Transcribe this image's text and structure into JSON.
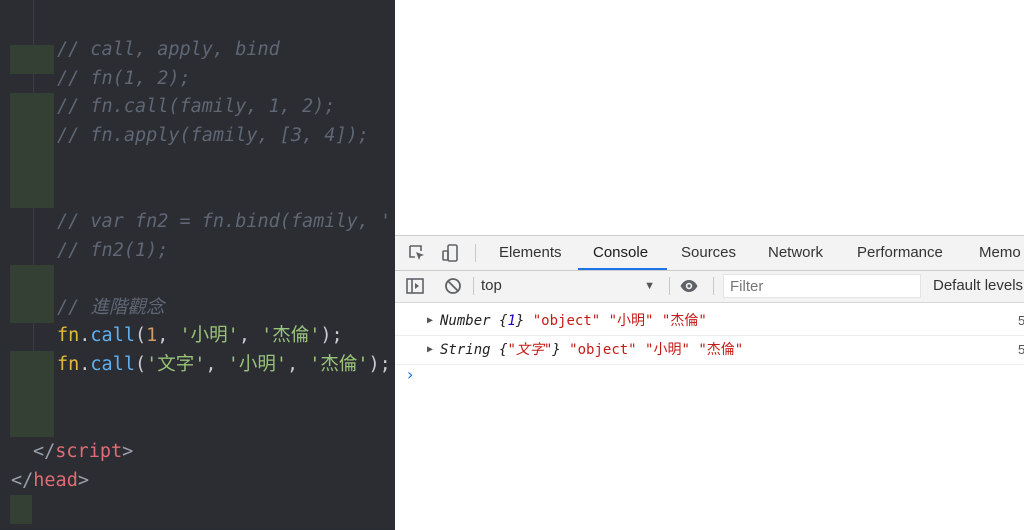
{
  "editor": {
    "lines": [
      {
        "comment": "// call, apply, bind"
      },
      {
        "comment": "// fn(1, 2);"
      },
      {
        "comment": "// fn.call(family, 1, 2);"
      },
      {
        "comment": "// fn.apply(family, [3, 4]);"
      },
      {
        "comment": "// var fn2 = fn.bind(family, '"
      },
      {
        "comment": "// fn2(1);"
      },
      {
        "comment": "// 進階觀念"
      }
    ],
    "call1": {
      "obj": "fn",
      "dot": ".",
      "method": "call",
      "open": "(",
      "arg1": "1",
      "c1": ", ",
      "arg2": "'小明'",
      "c2": ", ",
      "arg3": "'杰倫'",
      "close": ");"
    },
    "call2": {
      "obj": "fn",
      "dot": ".",
      "method": "call",
      "open": "(",
      "arg1": "'文字'",
      "c1": ", ",
      "arg2": "'小明'",
      "c2": ", ",
      "arg3": "'杰倫'",
      "close": ");"
    },
    "script_close": {
      "lt": "</",
      "name": "script",
      "gt": ">"
    },
    "head_close": {
      "lt": "</",
      "name": "head",
      "gt": ">"
    }
  },
  "devtools": {
    "tabs": [
      "Elements",
      "Console",
      "Sources",
      "Network",
      "Performance",
      "Memo"
    ],
    "active_tab": "Console",
    "context": "top",
    "filter_placeholder": "Filter",
    "levels_label": "Default levels",
    "logs": [
      {
        "type": "Number",
        "open": " {",
        "val": "1",
        "close": "}",
        "rest1": " ",
        "s1": "\"object\"",
        "sp": " ",
        "s2": "\"小明\"",
        "sp2": " ",
        "s3": "\"杰倫\""
      },
      {
        "type": "String",
        "open": " {",
        "val": "\"文字\"",
        "close": "}",
        "rest1": " ",
        "s1": "\"object\"",
        "sp": " ",
        "s2": "\"小明\"",
        "sp2": " ",
        "s3": "\"杰倫\""
      }
    ],
    "source_marker": "5",
    "prompt": "›"
  },
  "colors": {
    "accent": "#1a73e8",
    "editor_bg": "#2b2d33",
    "string": "#98c379",
    "keyword_fn": "#e2b93d"
  }
}
